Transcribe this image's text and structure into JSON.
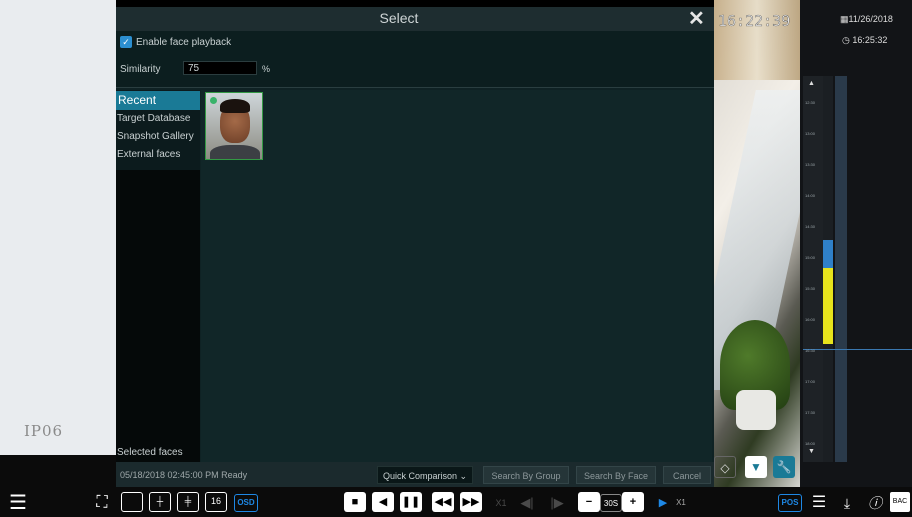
{
  "camera": {
    "ip_label": "IP06",
    "clock_overlay": "16:22:39"
  },
  "timeline": {
    "date": "11/26/2018",
    "time": "16:25:32",
    "ticks": [
      "12:30",
      "13:00",
      "13:30",
      "14:00",
      "14:30",
      "15:00",
      "15:30",
      "16:00",
      "16:30",
      "17:00",
      "17:30",
      "18:00"
    ]
  },
  "dialog": {
    "title": "Select",
    "close_icon": "close-icon",
    "enable_face_playback": {
      "label": "Enable face playback",
      "checked": true
    },
    "similarity": {
      "label": "Similarity",
      "value": "75",
      "unit": "%"
    },
    "sidebar": {
      "items": [
        "Recent",
        "Target Database",
        "Snapshot Gallery",
        "External faces"
      ],
      "selected": "Recent",
      "selected_faces_label": "Selected faces"
    },
    "footer": {
      "status": "05/18/2018 02:45:00 PM Ready",
      "quick_comparison": "Quick Comparison",
      "search_by_group": "Search By Group",
      "search_by_face": "Search By Face",
      "cancel": "Cancel"
    }
  },
  "toolbar": {
    "osd": "OSD",
    "speed_left": "X1",
    "interval": "30S",
    "speed_right": "X1",
    "pos": "POS",
    "back": "BAC"
  },
  "colors": {
    "accent_blue": "#1a7a96",
    "toolbar_blue": "#1e88e5",
    "timeline_yellow": "#e7e41c",
    "timeline_blue": "#2f80c8"
  }
}
